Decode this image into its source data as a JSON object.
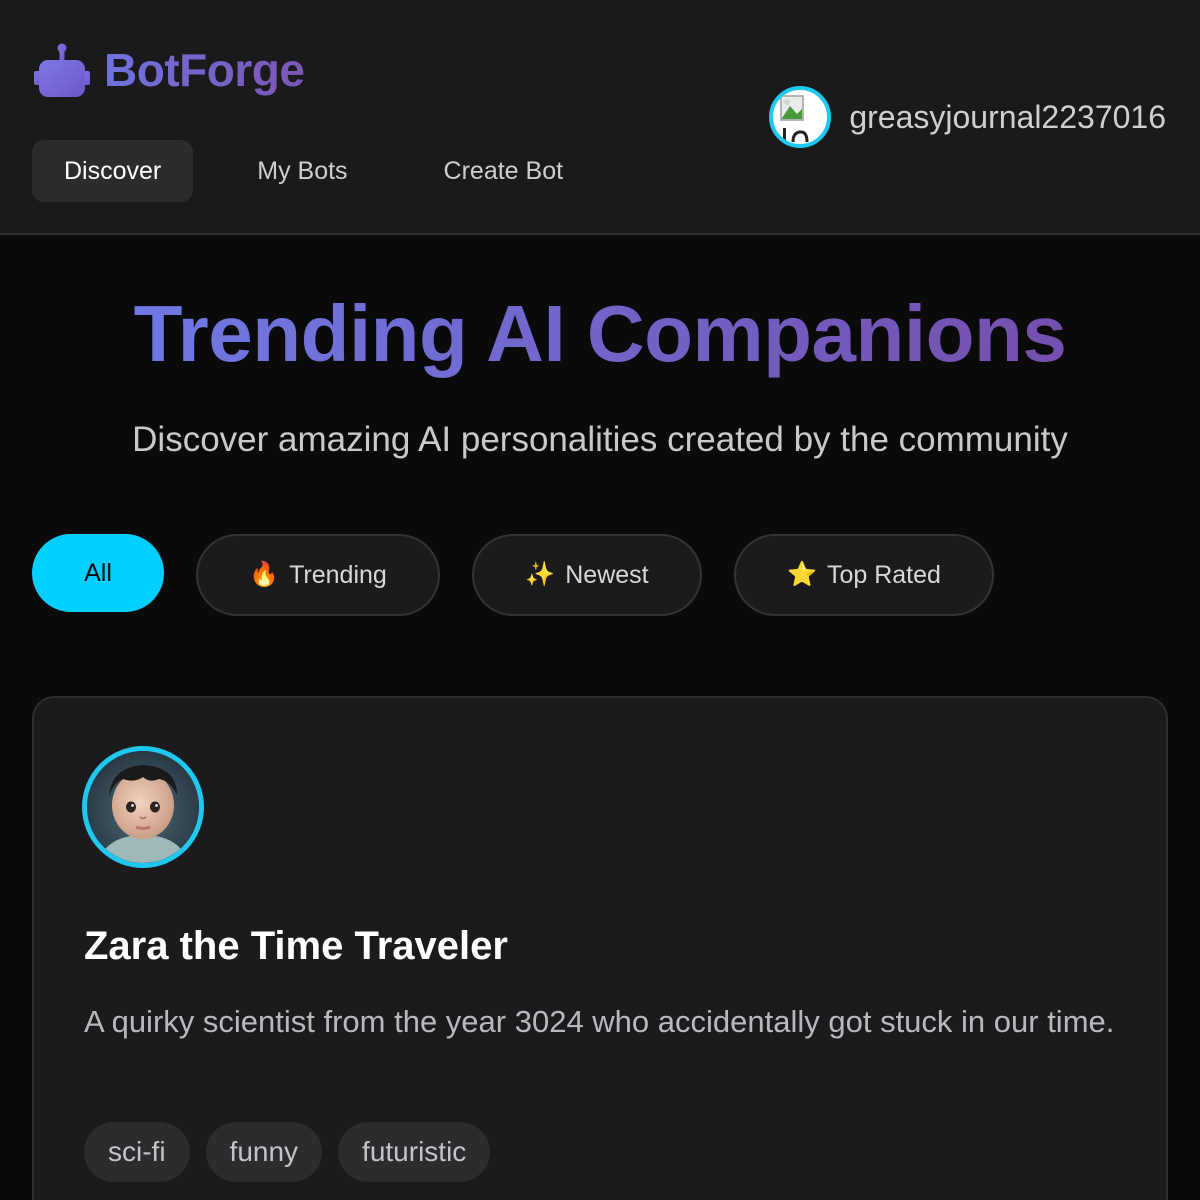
{
  "brand": {
    "name": "BotForge",
    "gradient": [
      "#6f72dd",
      "#7b56b4"
    ]
  },
  "nav": {
    "items": [
      {
        "label": "Discover",
        "active": true
      },
      {
        "label": "My Bots",
        "active": false
      },
      {
        "label": "Create Bot",
        "active": false
      }
    ]
  },
  "user": {
    "username": "greasyjournal2237016",
    "avatar_icon": "broken-image-icon"
  },
  "hero": {
    "title": "Trending AI Companions",
    "subtitle": "Discover amazing AI personalities created by the community"
  },
  "filters": [
    {
      "label": "All",
      "icon": "",
      "active": true
    },
    {
      "label": "Trending",
      "icon": "🔥",
      "active": false
    },
    {
      "label": "Newest",
      "icon": "✨",
      "active": false
    },
    {
      "label": "Top Rated",
      "icon": "⭐",
      "active": false
    }
  ],
  "bots": [
    {
      "name": "Zara the Time Traveler",
      "description": "A quirky scientist from the year 3024 who accidentally got stuck in our time.",
      "tags": [
        "sci-fi",
        "funny",
        "futuristic"
      ]
    }
  ],
  "colors": {
    "accent": "#00cfff",
    "avatar_ring": "#1ec8ef",
    "background": "#0a0a0b",
    "surface": "#1b1b1d"
  }
}
